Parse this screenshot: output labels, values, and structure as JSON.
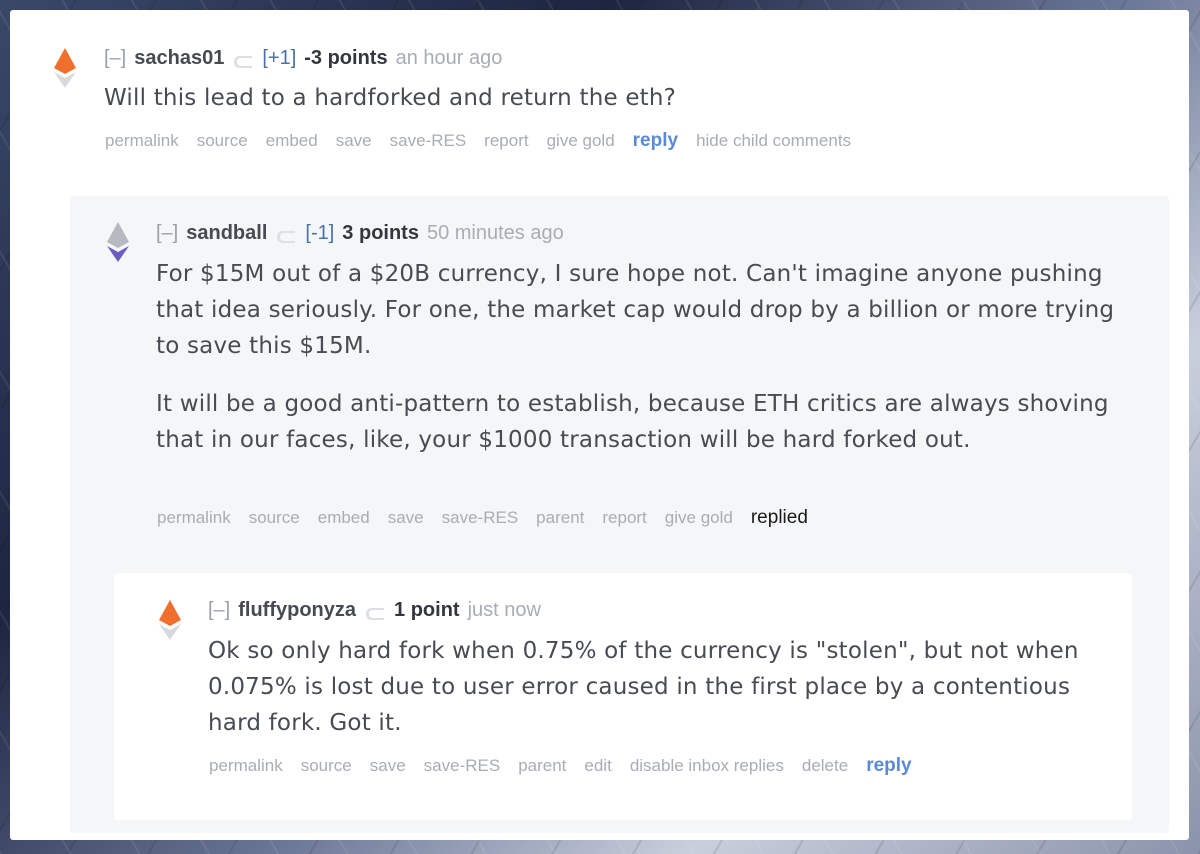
{
  "comments": [
    {
      "collapse": "[–]",
      "author": "sachas01",
      "karma": "[+1]",
      "score": "-3 points",
      "time": "an hour ago",
      "body": [
        "Will this lead to a hardforked and return the eth?"
      ],
      "buttons": [
        "permalink",
        "source",
        "embed",
        "save",
        "save-RES",
        "report",
        "give gold"
      ],
      "reply_label": "reply",
      "extra_button": "hide child comments",
      "icon": "orange-eth-icon",
      "icon_color": "#f16f2c"
    },
    {
      "collapse": "[–]",
      "author": "sandball",
      "karma": "[-1]",
      "score": "3 points",
      "time": "50 minutes ago",
      "body": [
        "For $15M out of a $20B currency, I sure hope not. Can't imagine anyone pushing that idea seriously. For one, the market cap would drop by a billion or more trying to save this $15M.",
        "It will be a good anti-pattern to establish, because ETH critics are always shoving that in our faces, like, your $1000 transaction will be hard forked out."
      ],
      "buttons": [
        "permalink",
        "source",
        "embed",
        "save",
        "save-RES",
        "parent",
        "report",
        "give gold"
      ],
      "replied_label": "replied",
      "icon": "purple-eth-icon",
      "icon_color": "#6c5cc4"
    },
    {
      "collapse": "[–]",
      "author": "fluffyponyza",
      "score": "1 point",
      "time": "just now",
      "body": [
        "Ok so only hard fork when 0.75% of the currency is \"stolen\", but not when 0.075% is lost due to user error caused in the first place by a contentious hard fork. Got it."
      ],
      "buttons": [
        "permalink",
        "source",
        "save",
        "save-RES",
        "parent",
        "edit",
        "disable inbox replies",
        "delete"
      ],
      "reply_label": "reply",
      "icon": "orange-eth-icon",
      "icon_color": "#f16f2c"
    }
  ],
  "colors": {
    "reply_link": "#5a8ad6",
    "karma": "#4a71a8",
    "text": "#474b52",
    "muted": "#a8adb5"
  }
}
